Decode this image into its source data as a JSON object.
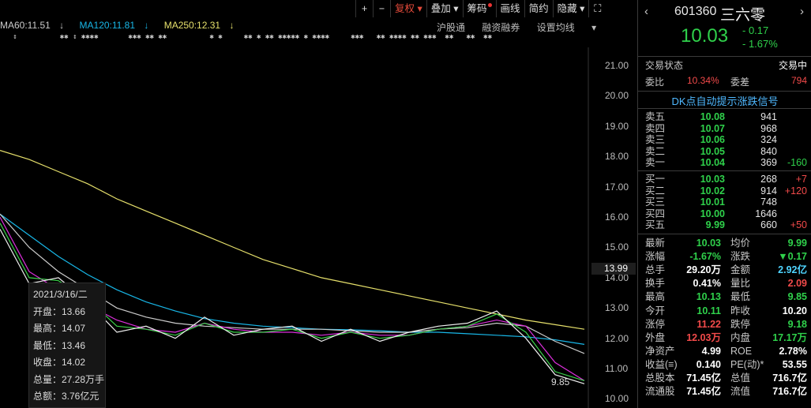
{
  "toolbar": {
    "plus": "+",
    "minus": "−",
    "fuquan": "复权",
    "diejia": "叠加",
    "chouma": "筹码",
    "huaxian": "画线",
    "jianyue": "简约",
    "yincang": "隐藏"
  },
  "ma": [
    {
      "label": "MA60:11.51",
      "arrow": "↓",
      "color": "#cccccc"
    },
    {
      "label": "MA120:11.81",
      "arrow": "↓",
      "color": "#18b7e8"
    },
    {
      "label": "MA250:12.31",
      "arrow": "↓",
      "color": "#e6e06b"
    }
  ],
  "subtoolbar": {
    "hgt": "沪股通",
    "rzrq": "融资融券",
    "sz": "设置均线"
  },
  "y_ticks": [
    "21.00",
    "20.00",
    "19.00",
    "18.00",
    "17.00",
    "16.00",
    "15.00",
    "14.00",
    "13.00",
    "12.00",
    "11.00",
    "10.00"
  ],
  "current_price_tag": "13.99",
  "low_label": "9.85",
  "tooltip": {
    "date": "2021/3/16/二",
    "open": "开盘：13.66",
    "high": "最高：14.07",
    "low": "最低：13.46",
    "close": "收盘：14.02",
    "volume": "总量：27.28万手",
    "amount": "总额：3.76亿元"
  },
  "chart_data": {
    "type": "line",
    "ylim": [
      9.7,
      21.6
    ],
    "series": [
      {
        "key": "ma250",
        "color": "#e6e06b",
        "values": [
          18.2,
          17.9,
          17.5,
          17.1,
          16.6,
          16.2,
          15.8,
          15.4,
          15.0,
          14.6,
          14.3,
          14.0,
          13.8,
          13.6,
          13.4,
          13.2,
          13.0,
          12.8,
          12.6,
          12.45,
          12.3
        ]
      },
      {
        "key": "ma120",
        "color": "#18b7e8",
        "values": [
          16.1,
          15.4,
          14.7,
          14.1,
          13.6,
          13.2,
          12.9,
          12.65,
          12.5,
          12.4,
          12.35,
          12.3,
          12.28,
          12.25,
          12.2,
          12.2,
          12.15,
          12.1,
          12.05,
          11.95,
          11.8
        ]
      },
      {
        "key": "ma60",
        "color": "#cccccc",
        "values": [
          16.1,
          15.0,
          14.2,
          13.6,
          13.0,
          12.7,
          12.5,
          12.4,
          12.35,
          12.3,
          12.3,
          12.3,
          12.25,
          12.2,
          12.2,
          12.3,
          12.35,
          12.5,
          12.4,
          11.9,
          11.5
        ]
      },
      {
        "key": "ma20",
        "color": "#dd2fdd",
        "values": [
          16.0,
          14.2,
          13.6,
          13.1,
          12.6,
          12.3,
          12.2,
          12.5,
          12.3,
          12.2,
          12.2,
          12.1,
          12.2,
          12.1,
          12.1,
          12.3,
          12.4,
          12.6,
          12.4,
          11.2,
          10.6
        ]
      },
      {
        "key": "ma10",
        "color": "#3bd04a",
        "values": [
          15.8,
          14.0,
          13.9,
          13.3,
          12.4,
          12.3,
          12.1,
          12.5,
          12.2,
          12.2,
          12.3,
          12.0,
          12.2,
          12.0,
          12.1,
          12.3,
          12.4,
          12.8,
          12.2,
          10.9,
          10.6
        ]
      },
      {
        "key": "ma5",
        "color": "#f0f0f0",
        "values": [
          15.6,
          13.8,
          14.0,
          13.2,
          12.2,
          12.4,
          12.0,
          12.7,
          12.1,
          12.3,
          12.4,
          11.9,
          12.3,
          11.9,
          12.2,
          12.4,
          12.5,
          12.9,
          12.0,
          10.8,
          10.5
        ]
      }
    ]
  },
  "panel": {
    "code": "601360",
    "name": "三六零",
    "price": "10.03",
    "change": "- 0.17",
    "change_pct": "- 1.67%",
    "trade_status_label": "交易状态",
    "trade_status_value": "交易中",
    "weibi_label": "委比",
    "weibi_value": "10.34%",
    "weicha_label": "委差",
    "weicha_value": "794",
    "signal": "DK点自动提示涨跌信号",
    "asks": [
      {
        "name": "卖五",
        "price": "10.08",
        "vol": "941",
        "chg": ""
      },
      {
        "name": "卖四",
        "price": "10.07",
        "vol": "968",
        "chg": ""
      },
      {
        "name": "卖三",
        "price": "10.06",
        "vol": "324",
        "chg": ""
      },
      {
        "name": "卖二",
        "price": "10.05",
        "vol": "840",
        "chg": ""
      },
      {
        "name": "卖一",
        "price": "10.04",
        "vol": "369",
        "chg": "-160"
      }
    ],
    "bids": [
      {
        "name": "买一",
        "price": "10.03",
        "vol": "268",
        "chg": "+7"
      },
      {
        "name": "买二",
        "price": "10.02",
        "vol": "914",
        "chg": "+120"
      },
      {
        "name": "买三",
        "price": "10.01",
        "vol": "748",
        "chg": ""
      },
      {
        "name": "买四",
        "price": "10.00",
        "vol": "1646",
        "chg": ""
      },
      {
        "name": "买五",
        "price": "9.99",
        "vol": "660",
        "chg": "+50"
      }
    ],
    "stats": [
      {
        "l1": "最新",
        "v1": "10.03",
        "c1": "green",
        "l2": "均价",
        "v2": "9.99",
        "c2": "green"
      },
      {
        "l1": "涨幅",
        "v1": "-1.67%",
        "c1": "green",
        "l2": "涨跌",
        "v2": "▼0.17",
        "c2": "green"
      },
      {
        "l1": "总手",
        "v1": "29.20万",
        "c1": "white",
        "l2": "金额",
        "v2": "2.92亿",
        "c2": "cyan"
      },
      {
        "l1": "换手",
        "v1": "0.41%",
        "c1": "white",
        "l2": "量比",
        "v2": "2.09",
        "c2": "red"
      },
      {
        "l1": "最高",
        "v1": "10.13",
        "c1": "green",
        "l2": "最低",
        "v2": "9.85",
        "c2": "green"
      },
      {
        "l1": "今开",
        "v1": "10.11",
        "c1": "green",
        "l2": "昨收",
        "v2": "10.20",
        "c2": "white"
      },
      {
        "l1": "涨停",
        "v1": "11.22",
        "c1": "red",
        "l2": "跌停",
        "v2": "9.18",
        "c2": "green"
      },
      {
        "l1": "外盘",
        "v1": "12.03万",
        "c1": "red",
        "l2": "内盘",
        "v2": "17.17万",
        "c2": "green"
      },
      {
        "l1": "净资产",
        "v1": "4.99",
        "c1": "white",
        "l2": "ROE",
        "v2": "2.78%",
        "c2": "white"
      },
      {
        "l1": "收益(≡)",
        "v1": "0.140",
        "c1": "white",
        "l2": "PE(动)*",
        "v2": "53.55",
        "c2": "white"
      },
      {
        "l1": "总股本",
        "v1": "71.45亿",
        "c1": "white",
        "l2": "总值",
        "v2": "716.7亿",
        "c2": "white"
      },
      {
        "l1": "流通股",
        "v1": "71.45亿",
        "c1": "white",
        "l2": "流值",
        "v2": "716.7亿",
        "c2": "white"
      }
    ]
  }
}
